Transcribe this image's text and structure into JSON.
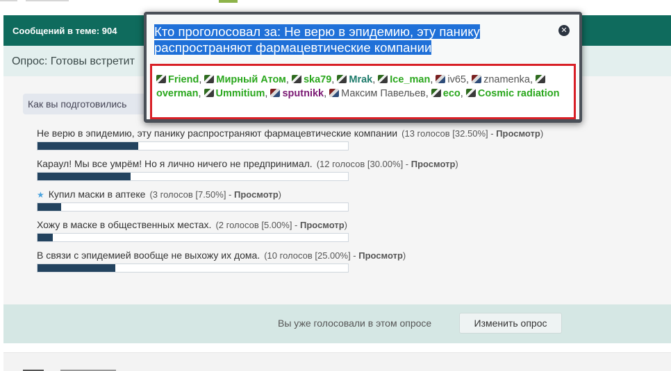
{
  "topic": {
    "messages_count": "Сообщений в теме: 904"
  },
  "poll": {
    "title": "Опрос: Готовы встретит",
    "question": "Как вы подготовились",
    "options": [
      {
        "label": "Не верю в эпидемию, эту панику распространяют фармацевтические компании",
        "votes": "(13 голосов [32.50%] - ",
        "view": "Просмотр",
        "close": ")",
        "fraction": 0.325
      },
      {
        "label": "Караул! Мы все умрём! Но я лично ничего не предпринимал.",
        "votes": "(12 голосов [30.00%] - ",
        "view": "Просмотр",
        "close": ")",
        "fraction": 0.3
      },
      {
        "label": "Купил маски в аптеке",
        "votes": "(3 голосов [7.50%] - ",
        "view": "Просмотр",
        "close": ")",
        "fraction": 0.075,
        "starred": true
      },
      {
        "label": "Хожу в маске в общественных местах.",
        "votes": "(2 голосов [5.00%] - ",
        "view": "Просмотр",
        "close": ")",
        "fraction": 0.05
      },
      {
        "label": "В связи с эпидемией вообще не выхожу их дома.",
        "votes": "(10 голосов [25.00%] - ",
        "view": "Просмотр",
        "close": ")",
        "fraction": 0.25
      }
    ],
    "voted_text": "Вы уже голосовали в этом опросе",
    "change_button": "Изменить опрос"
  },
  "popup": {
    "title": "Кто проголосовал за: Не верю в эпидемию, эту панику распространяют фармацевтические компании",
    "close_icon": "close-icon",
    "voters": [
      {
        "name": "Friend",
        "style": "green"
      },
      {
        "name": "Мирный Атом",
        "style": "green"
      },
      {
        "name": "ska79",
        "style": "green"
      },
      {
        "name": "Mrak",
        "style": "teal"
      },
      {
        "name": "Ice_man",
        "style": "green"
      },
      {
        "name": "iv65",
        "style": "plain",
        "icon": "alt"
      },
      {
        "name": "znamenka",
        "style": "plain",
        "icon": "alt"
      },
      {
        "name": "overman",
        "style": "green"
      },
      {
        "name": "Ummitium",
        "style": "green"
      },
      {
        "name": "sputnikk",
        "style": "purple",
        "icon": "alt"
      },
      {
        "name": "Максим Павельев",
        "style": "plain",
        "icon": "alt"
      },
      {
        "name": "eco",
        "style": "green"
      },
      {
        "name": "Cosmic radiation",
        "style": "green"
      }
    ]
  }
}
